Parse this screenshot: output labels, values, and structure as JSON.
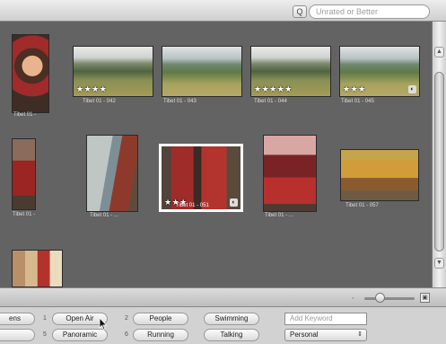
{
  "toolbar": {
    "search_button": "Q",
    "search_placeholder": "Unrated or Better"
  },
  "browser": {
    "rows": [
      {
        "captions": [
          "Tibet 01 -",
          "Tibet 01 - 042",
          "Tibet 01 - 043",
          "Tibet 01 - 044",
          "Tibet 01 - 045"
        ],
        "stars": [
          "",
          "★★★★",
          "",
          "★★★★★",
          "★★★"
        ]
      },
      {
        "captions": [
          "Tibet 01 -",
          "Tibet 01 - ...",
          "Tibet 01 - 051",
          "Tibet 01 - ...",
          "Tibet 01 - 057"
        ],
        "stars": [
          "",
          "",
          "★★★",
          "",
          ""
        ]
      },
      {
        "captions": [
          ""
        ],
        "stars": [
          ""
        ]
      }
    ],
    "badge_glyph": "◐"
  },
  "scrollbar": {
    "up": "▲",
    "down": "▼"
  },
  "zoom": {
    "small_label": "◦",
    "large_label": "▣",
    "level": 0.3
  },
  "keywords": {
    "row1": [
      "ens",
      "Open Air",
      "People",
      "Swimming"
    ],
    "row2": [
      "",
      "Panoramic",
      "Running",
      "Talking"
    ],
    "keys": [
      "1",
      "2",
      "3",
      "4",
      "5",
      "6",
      "7"
    ],
    "add_placeholder": "Add Keyword",
    "set_selected": "Personal",
    "set_arrows": "⇕"
  }
}
